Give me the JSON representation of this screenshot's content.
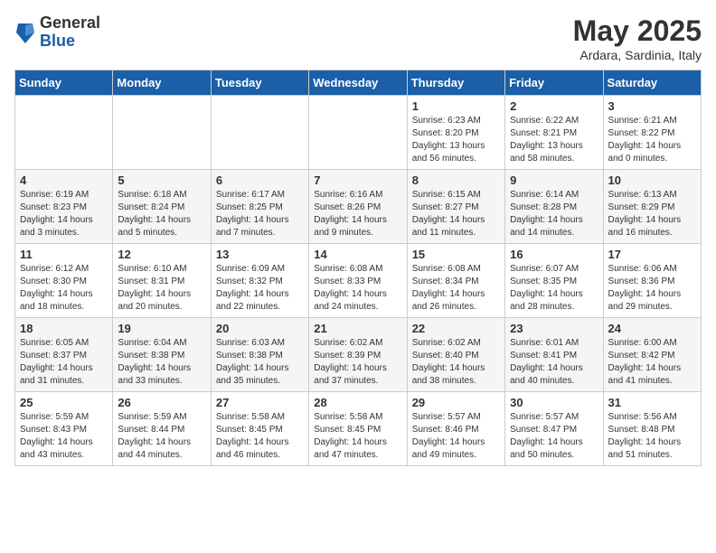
{
  "logo": {
    "general": "General",
    "blue": "Blue"
  },
  "title": "May 2025",
  "subtitle": "Ardara, Sardinia, Italy",
  "weekdays": [
    "Sunday",
    "Monday",
    "Tuesday",
    "Wednesday",
    "Thursday",
    "Friday",
    "Saturday"
  ],
  "weeks": [
    [
      {
        "day": "",
        "info": ""
      },
      {
        "day": "",
        "info": ""
      },
      {
        "day": "",
        "info": ""
      },
      {
        "day": "",
        "info": ""
      },
      {
        "day": "1",
        "info": "Sunrise: 6:23 AM\nSunset: 8:20 PM\nDaylight: 13 hours\nand 56 minutes."
      },
      {
        "day": "2",
        "info": "Sunrise: 6:22 AM\nSunset: 8:21 PM\nDaylight: 13 hours\nand 58 minutes."
      },
      {
        "day": "3",
        "info": "Sunrise: 6:21 AM\nSunset: 8:22 PM\nDaylight: 14 hours\nand 0 minutes."
      }
    ],
    [
      {
        "day": "4",
        "info": "Sunrise: 6:19 AM\nSunset: 8:23 PM\nDaylight: 14 hours\nand 3 minutes."
      },
      {
        "day": "5",
        "info": "Sunrise: 6:18 AM\nSunset: 8:24 PM\nDaylight: 14 hours\nand 5 minutes."
      },
      {
        "day": "6",
        "info": "Sunrise: 6:17 AM\nSunset: 8:25 PM\nDaylight: 14 hours\nand 7 minutes."
      },
      {
        "day": "7",
        "info": "Sunrise: 6:16 AM\nSunset: 8:26 PM\nDaylight: 14 hours\nand 9 minutes."
      },
      {
        "day": "8",
        "info": "Sunrise: 6:15 AM\nSunset: 8:27 PM\nDaylight: 14 hours\nand 11 minutes."
      },
      {
        "day": "9",
        "info": "Sunrise: 6:14 AM\nSunset: 8:28 PM\nDaylight: 14 hours\nand 14 minutes."
      },
      {
        "day": "10",
        "info": "Sunrise: 6:13 AM\nSunset: 8:29 PM\nDaylight: 14 hours\nand 16 minutes."
      }
    ],
    [
      {
        "day": "11",
        "info": "Sunrise: 6:12 AM\nSunset: 8:30 PM\nDaylight: 14 hours\nand 18 minutes."
      },
      {
        "day": "12",
        "info": "Sunrise: 6:10 AM\nSunset: 8:31 PM\nDaylight: 14 hours\nand 20 minutes."
      },
      {
        "day": "13",
        "info": "Sunrise: 6:09 AM\nSunset: 8:32 PM\nDaylight: 14 hours\nand 22 minutes."
      },
      {
        "day": "14",
        "info": "Sunrise: 6:08 AM\nSunset: 8:33 PM\nDaylight: 14 hours\nand 24 minutes."
      },
      {
        "day": "15",
        "info": "Sunrise: 6:08 AM\nSunset: 8:34 PM\nDaylight: 14 hours\nand 26 minutes."
      },
      {
        "day": "16",
        "info": "Sunrise: 6:07 AM\nSunset: 8:35 PM\nDaylight: 14 hours\nand 28 minutes."
      },
      {
        "day": "17",
        "info": "Sunrise: 6:06 AM\nSunset: 8:36 PM\nDaylight: 14 hours\nand 29 minutes."
      }
    ],
    [
      {
        "day": "18",
        "info": "Sunrise: 6:05 AM\nSunset: 8:37 PM\nDaylight: 14 hours\nand 31 minutes."
      },
      {
        "day": "19",
        "info": "Sunrise: 6:04 AM\nSunset: 8:38 PM\nDaylight: 14 hours\nand 33 minutes."
      },
      {
        "day": "20",
        "info": "Sunrise: 6:03 AM\nSunset: 8:38 PM\nDaylight: 14 hours\nand 35 minutes."
      },
      {
        "day": "21",
        "info": "Sunrise: 6:02 AM\nSunset: 8:39 PM\nDaylight: 14 hours\nand 37 minutes."
      },
      {
        "day": "22",
        "info": "Sunrise: 6:02 AM\nSunset: 8:40 PM\nDaylight: 14 hours\nand 38 minutes."
      },
      {
        "day": "23",
        "info": "Sunrise: 6:01 AM\nSunset: 8:41 PM\nDaylight: 14 hours\nand 40 minutes."
      },
      {
        "day": "24",
        "info": "Sunrise: 6:00 AM\nSunset: 8:42 PM\nDaylight: 14 hours\nand 41 minutes."
      }
    ],
    [
      {
        "day": "25",
        "info": "Sunrise: 5:59 AM\nSunset: 8:43 PM\nDaylight: 14 hours\nand 43 minutes."
      },
      {
        "day": "26",
        "info": "Sunrise: 5:59 AM\nSunset: 8:44 PM\nDaylight: 14 hours\nand 44 minutes."
      },
      {
        "day": "27",
        "info": "Sunrise: 5:58 AM\nSunset: 8:45 PM\nDaylight: 14 hours\nand 46 minutes."
      },
      {
        "day": "28",
        "info": "Sunrise: 5:58 AM\nSunset: 8:45 PM\nDaylight: 14 hours\nand 47 minutes."
      },
      {
        "day": "29",
        "info": "Sunrise: 5:57 AM\nSunset: 8:46 PM\nDaylight: 14 hours\nand 49 minutes."
      },
      {
        "day": "30",
        "info": "Sunrise: 5:57 AM\nSunset: 8:47 PM\nDaylight: 14 hours\nand 50 minutes."
      },
      {
        "day": "31",
        "info": "Sunrise: 5:56 AM\nSunset: 8:48 PM\nDaylight: 14 hours\nand 51 minutes."
      }
    ]
  ]
}
